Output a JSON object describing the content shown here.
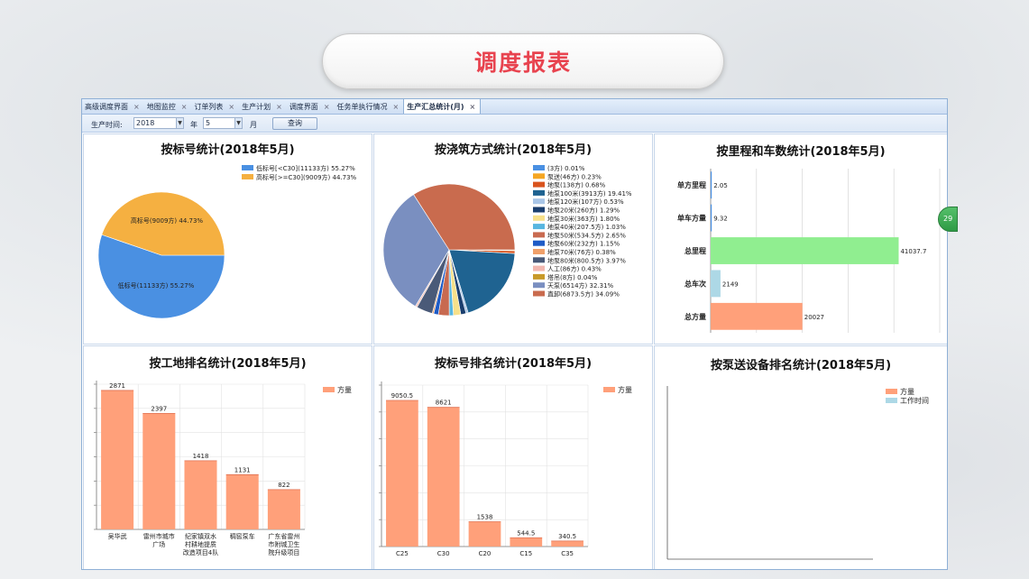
{
  "slide": {
    "title": "调度报表"
  },
  "tabs": [
    {
      "label": "高级调度界面",
      "active": false,
      "close": "×"
    },
    {
      "label": "地图监控",
      "active": false,
      "close": "×"
    },
    {
      "label": "订单列表",
      "active": false,
      "close": "×"
    },
    {
      "label": "生产计划",
      "active": false,
      "close": "×"
    },
    {
      "label": "调度界面",
      "active": false,
      "close": "×"
    },
    {
      "label": "任务单执行情况",
      "active": false,
      "close": "×"
    },
    {
      "label": "生产汇总统计(月)",
      "active": true,
      "close": "×"
    }
  ],
  "toolbar": {
    "time_label": "生产时间:",
    "year_value": "2018",
    "year_unit": "年",
    "month_value": "5",
    "month_unit": "月",
    "query_button": "查询",
    "dropdown_arrow": "▼"
  },
  "side_toggle": {
    "label": "29"
  },
  "panels": {
    "grade": {
      "title": "按标号统计(2018年5月)"
    },
    "pour": {
      "title": "按浇筑方式统计(2018年5月)"
    },
    "mileage": {
      "title": "按里程和车数统计(2018年5月)"
    },
    "site": {
      "title": "按工地排名统计(2018年5月)"
    },
    "grade_rank": {
      "title": "按标号排名统计(2018年5月)"
    },
    "pump": {
      "title": "按泵送设备排名统计(2018年5月)"
    }
  },
  "chart_data": [
    {
      "id": "grade",
      "type": "pie",
      "title": "按标号统计(2018年5月)",
      "legend_position": "top-right",
      "slices": [
        {
          "legend": "低标号[<C30](11133方) 55.27%",
          "label": "低标号(11133方) 55.27%",
          "value": 55.27,
          "color": "#4a90e2"
        },
        {
          "legend": "高标号[>=C30](9009方) 44.73%",
          "label": "高标号(9009方) 44.73%",
          "value": 44.73,
          "color": "#f5b041"
        }
      ]
    },
    {
      "id": "pour",
      "type": "pie",
      "title": "按浇筑方式统计(2018年5月)",
      "legend_position": "right",
      "slices": [
        {
          "legend": "(3方) 0.01%",
          "value": 0.01,
          "color": "#4a90e2"
        },
        {
          "legend": "泵送(46方) 0.23%",
          "value": 0.23,
          "color": "#f5a623"
        },
        {
          "legend": "地泵(138方) 0.68%",
          "value": 0.68,
          "color": "#d9541e"
        },
        {
          "legend": "地泵100米(3913方) 19.41%",
          "value": 19.41,
          "color": "#1f6391"
        },
        {
          "legend": "地泵120米(107方) 0.53%",
          "value": 0.53,
          "color": "#a9c6e8"
        },
        {
          "legend": "地泵20米(260方) 1.29%",
          "value": 1.29,
          "color": "#1a3e6e"
        },
        {
          "legend": "地泵30米(363方) 1.80%",
          "value": 1.8,
          "color": "#f7e08a"
        },
        {
          "legend": "地泵40米(207.5方) 1.03%",
          "value": 1.03,
          "color": "#58b6e0"
        },
        {
          "legend": "地泵50米(534.5方) 2.65%",
          "value": 2.65,
          "color": "#c86a50"
        },
        {
          "legend": "地泵60米(232方) 1.15%",
          "value": 1.15,
          "color": "#1e5bc6"
        },
        {
          "legend": "地泵70米(76方) 0.38%",
          "value": 0.38,
          "color": "#f0a06a"
        },
        {
          "legend": "地泵80米(800.5方) 3.97%",
          "value": 3.97,
          "color": "#4a5a78"
        },
        {
          "legend": "人工(86方) 0.43%",
          "value": 0.43,
          "color": "#f2b8b0"
        },
        {
          "legend": "塔吊(8方) 0.04%",
          "value": 0.04,
          "color": "#c89a2a"
        },
        {
          "legend": "天泵(6514方) 32.31%",
          "value": 32.31,
          "color": "#7a8fc0"
        },
        {
          "legend": "直卸(6873.5方) 34.09%",
          "value": 34.09,
          "color": "#c96b4e"
        }
      ]
    },
    {
      "id": "mileage",
      "type": "bar",
      "orientation": "horizontal",
      "title": "按里程和车数统计(2018年5月)",
      "grid": true,
      "xlim": [
        0,
        50000
      ],
      "categories": [
        "单方里程",
        "单车方量",
        "总里程",
        "总车次",
        "总方量"
      ],
      "values": [
        2.05,
        9.32,
        41037.7,
        2149,
        20027
      ],
      "data_labels": [
        "2.05",
        "9.32",
        "41037.7",
        "2149",
        "20027"
      ],
      "colors": [
        "#4a90e2",
        "#4a90e2",
        "#90ee90",
        "#add8e6",
        "#ffa07a"
      ]
    },
    {
      "id": "site",
      "type": "bar",
      "title": "按工地排名统计(2018年5月)",
      "grid": true,
      "ylim": [
        0,
        3000
      ],
      "legend_position": "top-right",
      "series": [
        {
          "name": "方量",
          "color": "#ffa07a",
          "categories": [
            [
              "吴华武"
            ],
            [
              "雷州市城市",
              "广场"
            ],
            [
              "纪家镇双水",
              "村耕地提质",
              "改造项目4队"
            ],
            [
              "稠窖泵车"
            ],
            [
              "广东省雷州",
              "市附城卫生",
              "院升级项目"
            ]
          ],
          "values": [
            2871,
            2397,
            1418,
            1131,
            822
          ],
          "data_labels": [
            "2871",
            "2397",
            "1418",
            "1131",
            "822"
          ]
        }
      ]
    },
    {
      "id": "grade_rank",
      "type": "bar",
      "title": "按标号排名统计(2018年5月)",
      "grid": true,
      "ylim": [
        0,
        10000
      ],
      "legend_position": "top-right",
      "series": [
        {
          "name": "方量",
          "color": "#ffa07a",
          "categories": [
            [
              "C25"
            ],
            [
              "C30"
            ],
            [
              "C20"
            ],
            [
              "C15"
            ],
            [
              "C35"
            ]
          ],
          "values": [
            9050.5,
            8621,
            1538,
            544.5,
            340.5
          ],
          "data_labels": [
            "9050.5",
            "8621",
            "1538",
            "544.5",
            "340.5"
          ]
        }
      ]
    },
    {
      "id": "pump",
      "type": "bar",
      "title": "按泵送设备排名统计(2018年5月)",
      "legend_position": "top-right",
      "series": [
        {
          "name": "方量",
          "color": "#ffa07a",
          "values": []
        },
        {
          "name": "工作时间",
          "color": "#add8e6",
          "values": []
        }
      ]
    }
  ]
}
